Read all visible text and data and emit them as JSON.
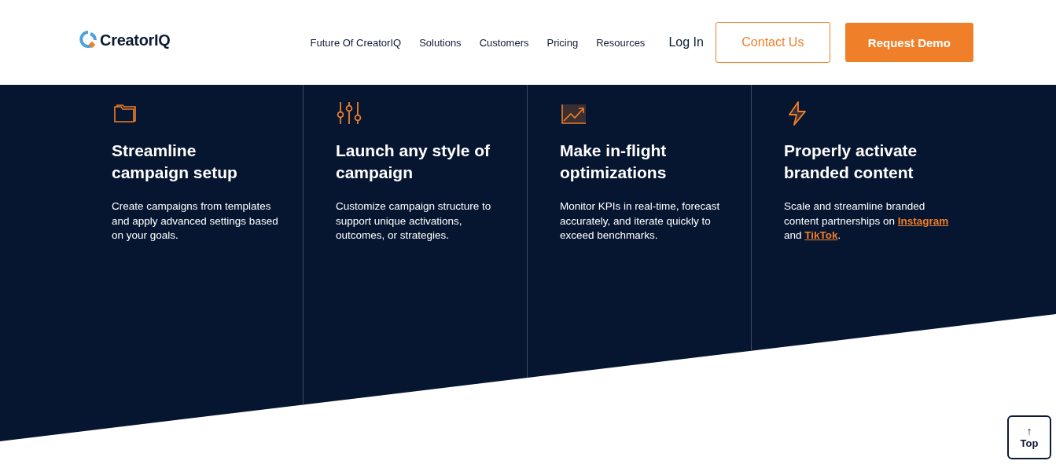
{
  "header": {
    "logo": "CreatorIQ",
    "nav": [
      "Future Of CreatorIQ",
      "Solutions",
      "Customers",
      "Pricing",
      "Resources"
    ],
    "login": "Log In",
    "contact_button": "Contact Us",
    "demo_button": "Request Demo"
  },
  "features": [
    {
      "title": "Streamline campaign setup",
      "description": [
        {
          "text": "Create campaigns from templates and apply advanced settings based on your goals."
        }
      ]
    },
    {
      "title": "Launch any style of campaign",
      "description": [
        {
          "text": "Customize campaign structure to support unique activations, outcomes, or strategies."
        }
      ]
    },
    {
      "title": "Make in-flight optimizations",
      "description": [
        {
          "text": "Monitor KPIs in real-time, forecast accurately, and iterate quickly to exceed benchmarks."
        }
      ]
    },
    {
      "title": "Properly activate branded content",
      "description": [
        {
          "text": "Scale and streamline branded content partnerships on "
        },
        {
          "text": "Instagram",
          "kind": "link"
        },
        {
          "text": " and "
        },
        {
          "text": "TikTok",
          "kind": "link"
        },
        {
          "text": "."
        }
      ]
    }
  ],
  "top_button": {
    "arrow": "↑",
    "label": "Top"
  }
}
